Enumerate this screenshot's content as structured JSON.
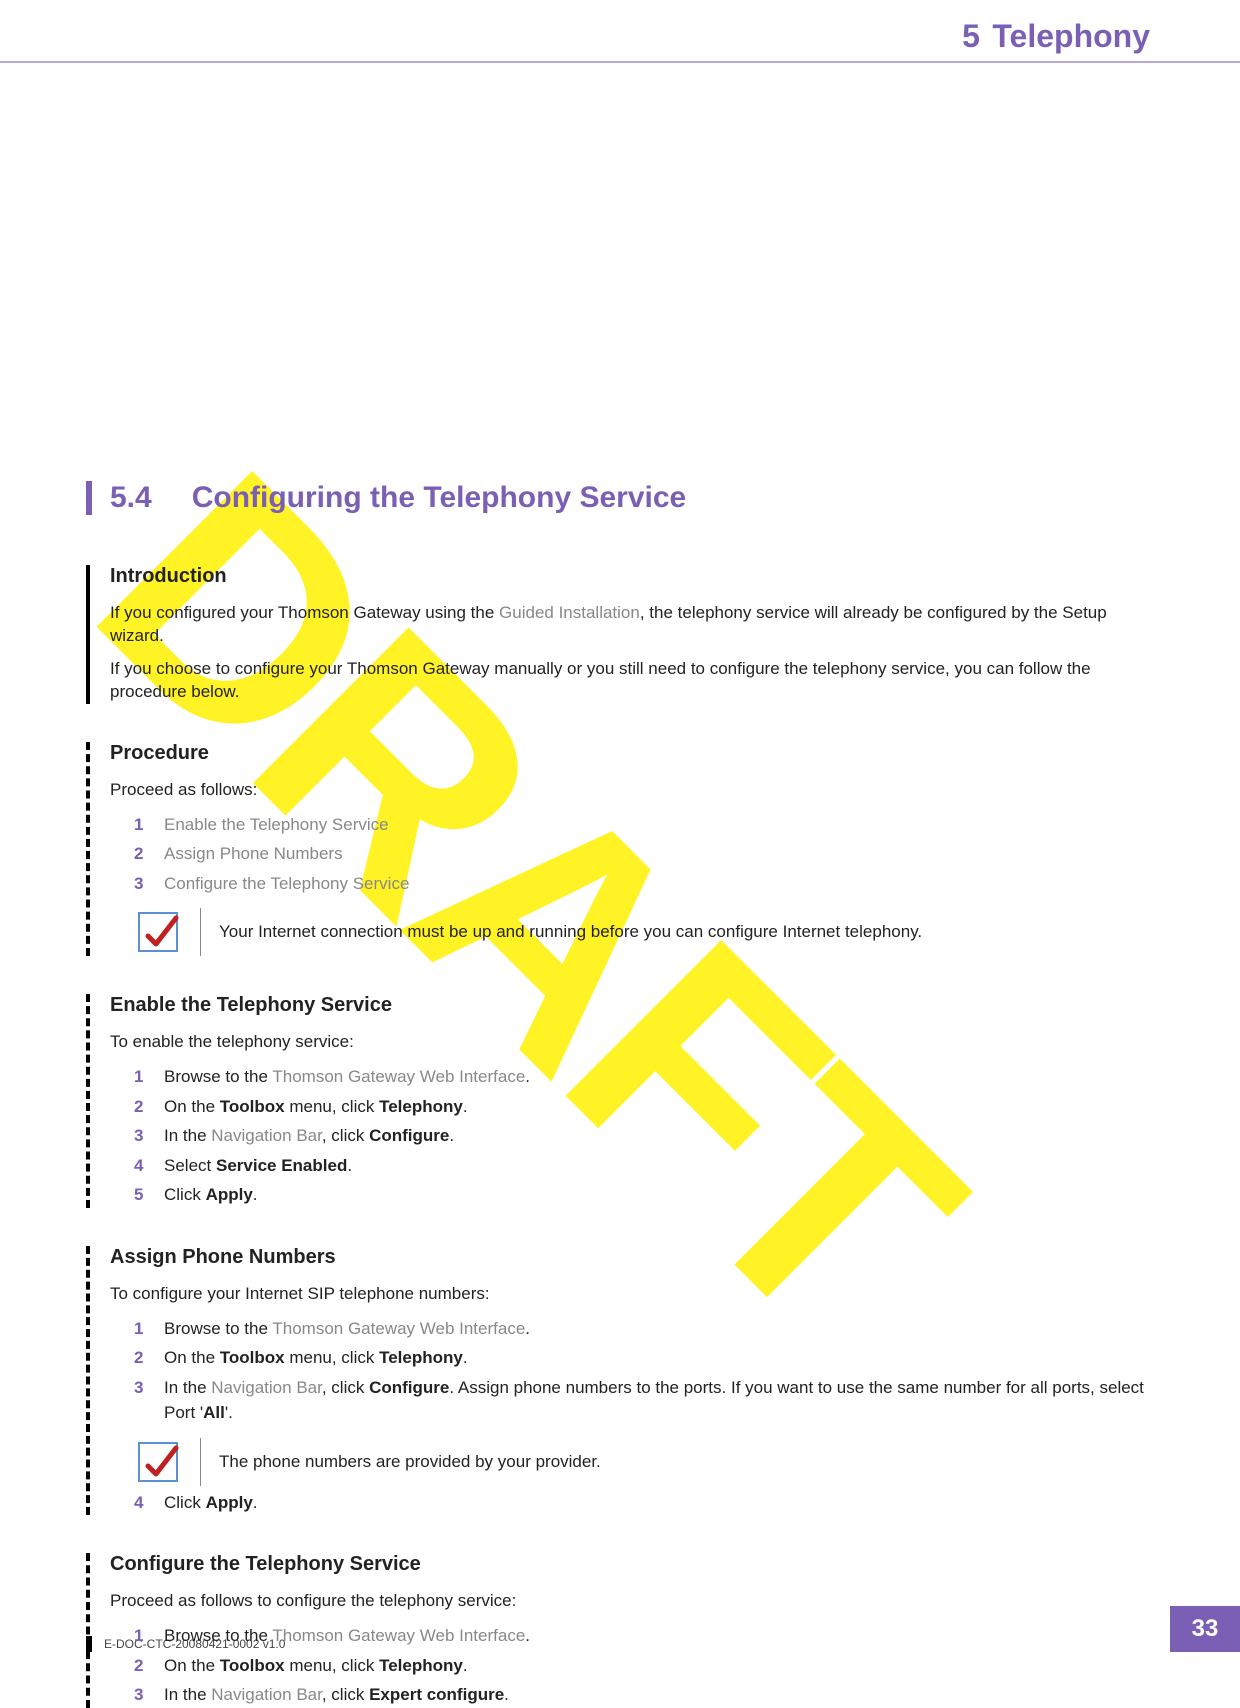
{
  "header": {
    "chapter_num": "5",
    "chapter_title": "Telephony"
  },
  "section": {
    "num": "5.4",
    "title": "Configuring the Telephony Service"
  },
  "intro": {
    "heading": "Introduction",
    "p1a": "If you configured your Thomson Gateway using the ",
    "p1_link": "Guided Installation",
    "p1b": ", the telephony service will already be configured by the Setup wizard.",
    "p2": "If you choose to configure your Thomson Gateway manually or you still need to configure the telephony service, you can follow the procedure below."
  },
  "procedure": {
    "heading": "Procedure",
    "intro": "Proceed as follows:",
    "steps": [
      "Enable the Telephony Service",
      "Assign Phone Numbers",
      "Configure the Telephony Service"
    ],
    "note": "Your Internet connection must be up and running before you can configure Internet telephony."
  },
  "enable": {
    "heading": "Enable the Telephony Service",
    "intro": "To enable the telephony service:",
    "s1a": "Browse to the ",
    "s1_link": "Thomson Gateway Web Interface",
    "s1b": ".",
    "s2a": "On the ",
    "s2b": "Toolbox",
    "s2c": " menu, click ",
    "s2d": "Telephony",
    "s2e": ".",
    "s3a": "In the ",
    "s3_link": "Navigation Bar",
    "s3b": ", click ",
    "s3c": "Configure",
    "s3d": ".",
    "s4a": "Select ",
    "s4b": "Service Enabled",
    "s4c": ".",
    "s5a": "Click ",
    "s5b": "Apply",
    "s5c": "."
  },
  "assign": {
    "heading": "Assign Phone Numbers",
    "intro": "To configure your Internet SIP telephone numbers:",
    "s1a": "Browse to the ",
    "s1_link": "Thomson Gateway Web Interface",
    "s1b": ".",
    "s2a": "On the ",
    "s2b": "Toolbox",
    "s2c": " menu, click ",
    "s2d": "Telephony",
    "s2e": ".",
    "s3a": "In the ",
    "s3_link": "Navigation Bar",
    "s3b": ", click ",
    "s3c": "Configure",
    "s3d": ". Assign phone numbers to the ports. If you want to use the same number for all ports, select Port '",
    "s3e": "All",
    "s3f": "'.",
    "note": "The phone numbers are provided by your provider.",
    "s4a": "Click ",
    "s4b": "Apply",
    "s4c": "."
  },
  "configure": {
    "heading": "Configure the Telephony Service",
    "intro": "Proceed as follows to configure the telephony service:",
    "s1a": "Browse to the ",
    "s1_link": "Thomson Gateway Web Interface",
    "s1b": ".",
    "s2a": "On the ",
    "s2b": "Toolbox",
    "s2c": " menu, click ",
    "s2d": "Telephony",
    "s2e": ".",
    "s3a": "In the ",
    "s3_link": "Navigation Bar",
    "s3b": ", click ",
    "s3c": "Expert configure",
    "s3d": "."
  },
  "watermark": "DRAFT",
  "footer": {
    "docid": "E-DOC-CTC-20080421-0002 v1.0",
    "page": "33"
  }
}
